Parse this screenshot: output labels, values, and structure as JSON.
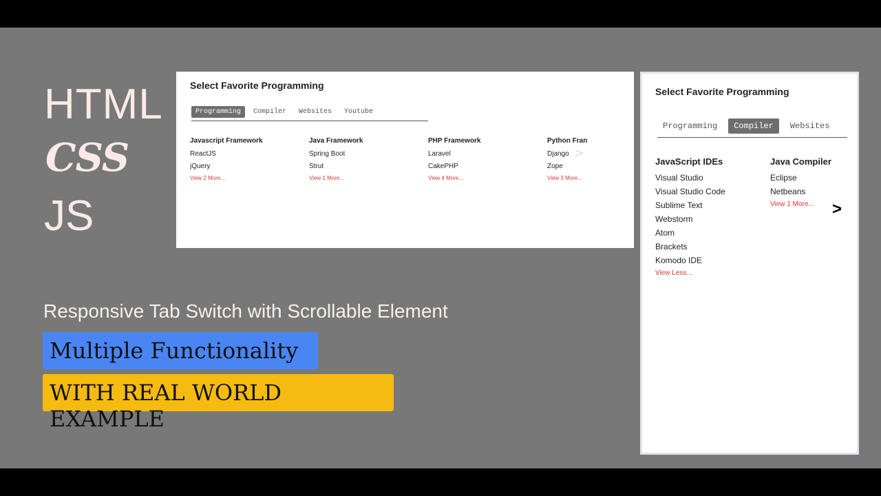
{
  "left": {
    "line1": "HTML",
    "line2": "CSS",
    "line3": "JS",
    "subtitle": "Responsive Tab Switch with Scrollable Element",
    "badge1": "Multiple Functionality",
    "badge2": "WITH REAL WORLD EXAMPLE"
  },
  "colors": {
    "stage": "#787878",
    "badge_blue": "#4a86f3",
    "badge_yellow": "#f6bb10",
    "link_red": "#e0332f",
    "active_tab": "#6e6e6e"
  },
  "wide_card": {
    "title": "Select Favorite Programming",
    "tabs": [
      "Programming",
      "Compiler",
      "Websites",
      "Youtube"
    ],
    "active_tab": 0,
    "scroll_arrow": ">",
    "columns": [
      {
        "head": "Javascript Framework",
        "items": [
          "ReactJS",
          "jQuery"
        ],
        "more": "View 2 More..."
      },
      {
        "head": "Java Framework",
        "items": [
          "Spring Boot",
          "Strut"
        ],
        "more": "View 1 More..."
      },
      {
        "head": "PHP Framework",
        "items": [
          "Laravel",
          "CakePHP"
        ],
        "more": "View 4 More..."
      },
      {
        "head": "Python Fran",
        "items": [
          "Django",
          "Zope"
        ],
        "more": "View 3 More..."
      }
    ]
  },
  "narrow_card": {
    "title": "Select Favorite Programming",
    "tabs": [
      "Programming",
      "Compiler",
      "Websites"
    ],
    "active_tab": 1,
    "scroll_arrow": ">",
    "columns": [
      {
        "head": "JavaScript IDEs",
        "items": [
          "Visual Studio",
          "Visual Studio Code",
          "Sublime Text",
          "Webstorm",
          "Atom",
          "Brackets",
          "Komodo IDE"
        ],
        "more": "View Less..."
      },
      {
        "head": "Java Compiler",
        "items": [
          "Eclipse",
          "Netbeans"
        ],
        "more": "View 1 More..."
      }
    ]
  }
}
